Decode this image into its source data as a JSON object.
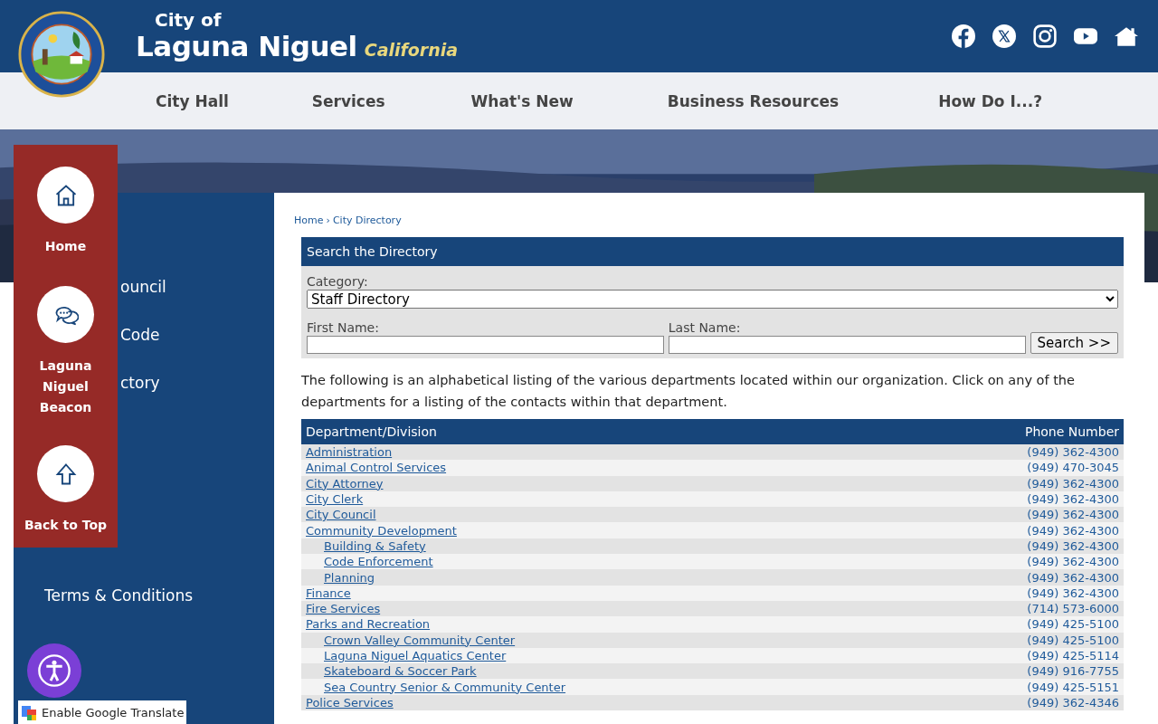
{
  "header": {
    "city_of": "City of",
    "city_name": "Laguna Niguel",
    "state": "California",
    "social": [
      {
        "kind": "facebook"
      },
      {
        "kind": "x"
      },
      {
        "kind": "instagram"
      },
      {
        "kind": "youtube"
      },
      {
        "kind": "home"
      }
    ]
  },
  "nav": [
    "City Hall",
    "Services",
    "What's New",
    "Business Resources",
    "How Do I...?"
  ],
  "sidebar": {
    "items": [
      "ouncil",
      "Code",
      "ctory",
      "Terms & Conditions"
    ]
  },
  "quick_links": [
    {
      "kind": "home",
      "label": "Home"
    },
    {
      "kind": "chat",
      "label": "Laguna Niguel Beacon"
    },
    {
      "kind": "up",
      "label": "Back to Top"
    }
  ],
  "breadcrumb": [
    "Home",
    "City Directory"
  ],
  "breadcrumb_separator": "›",
  "search": {
    "title": "Search the Directory",
    "category_label": "Category:",
    "category_value": "Staff Directory",
    "first_label": "First Name:",
    "last_label": "Last Name:",
    "button": "Search >>"
  },
  "intro": "The following is an alphabetical listing of the various departments located within our organization. Click on any of the departments for a listing of the contacts within that department.",
  "table": {
    "columns": [
      "Department/Division",
      "Phone Number"
    ],
    "rows": [
      {
        "name": "Administration",
        "phone": "(949) 362-4300"
      },
      {
        "name": "Animal Control Services",
        "phone": "(949) 470-3045"
      },
      {
        "name": "City Attorney",
        "phone": "(949) 362-4300"
      },
      {
        "name": "City Clerk",
        "phone": "(949) 362-4300"
      },
      {
        "name": "City Council",
        "phone": "(949) 362-4300"
      },
      {
        "name": "Community Development",
        "phone": "(949) 362-4300",
        "children": [
          {
            "name": "Building & Safety",
            "phone": "(949) 362-4300"
          },
          {
            "name": "Code Enforcement",
            "phone": "(949) 362-4300"
          },
          {
            "name": "Planning",
            "phone": "(949) 362-4300"
          }
        ]
      },
      {
        "name": "Finance",
        "phone": "(949) 362-4300"
      },
      {
        "name": "Fire Services",
        "phone": "(714) 573-6000"
      },
      {
        "name": "Parks and Recreation",
        "phone": "(949) 425-5100",
        "children": [
          {
            "name": "Crown Valley Community Center",
            "phone": "(949) 425-5100"
          },
          {
            "name": "Laguna Niguel Aquatics Center",
            "phone": "(949) 425-5114"
          },
          {
            "name": "Skateboard & Soccer Park",
            "phone": "(949) 916-7755"
          },
          {
            "name": "Sea Country Senior & Community Center",
            "phone": "(949) 425-5151"
          }
        ]
      },
      {
        "name": "Police Services",
        "phone": "(949) 362-4346"
      }
    ]
  },
  "translate": "Enable Google Translate"
}
